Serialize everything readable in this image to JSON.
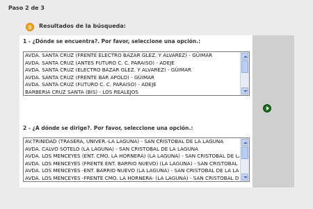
{
  "header": {
    "step": "Paso 2 de 3",
    "results_title": "Resultados de la búsqueda:"
  },
  "origin": {
    "label": "1 - ¿Dónde se encuentra?. Por favor, seleccione una opción.:",
    "options": [
      "AVDA. SANTA CRUZ (FRENTE ELECTRO BAZAR GLEZ. Y ALVAREZ) - GÜIMAR",
      "AVDA. SANTA CRUZ (ANTES FUTURO C. C. PARAISO) - ADEJE",
      "AVDA. SANTA CRUZ (ELECTRO BAZAR GLEZ. Y ALVAREZ) - GÜIMAR",
      "AVDA. SANTA CRUZ (FRENTE BAR APOLO) - GÜIMAR",
      "AVDA. SANTA CRUZ (FUTURO C. C. PARAISO) - ADEJE",
      "BARBERIA CRUZ SANTA (BIS) - LOS REALEJOS"
    ]
  },
  "destination": {
    "label": "2 - ¿A dónde se dirige?. Por favor, seleccione una opción.:",
    "options": [
      "AV.TRINIDAD (TRASERA, UNIVER.-LA LAGUNA) - SAN CRISTOBAL DE LA LAGUNA",
      "AVDA. CALVO SOTELO (LA LAGUNA) - SAN CRISTOBAL DE LA LAGUNA",
      "AVDA. LOS MENCEYES (ENT. CMO. LA HORNERA) (LA LAGUNA) - SAN CRISTOBAL DE LA LAGUNA",
      "AVDA. LOS MENCEYES (FRENTE ENT. BARRIO NUEVO) (LA LAGUNA) - SAN CRISTOBAL DE LA LAGUNA",
      "AVDA. LOS MENCEYES -ENT. BARRIO NUEVO (LA LAGUNA) - SAN CRISTOBAL DE LA LAGUNA",
      "AVDA. LOS MENCEYES -FRENTE CMO. LA HORNERA- (LA LAGUNA) - SAN CRISTOBAL DE LA LAGUNA"
    ]
  },
  "icons": {
    "results": "list-icon",
    "next": "next-arrow-icon"
  },
  "colors": {
    "results_icon": "#f2a21a",
    "next_button": "#1f6b1f",
    "panel_bg": "#ffffff",
    "side_column": "#cfcfcf"
  }
}
